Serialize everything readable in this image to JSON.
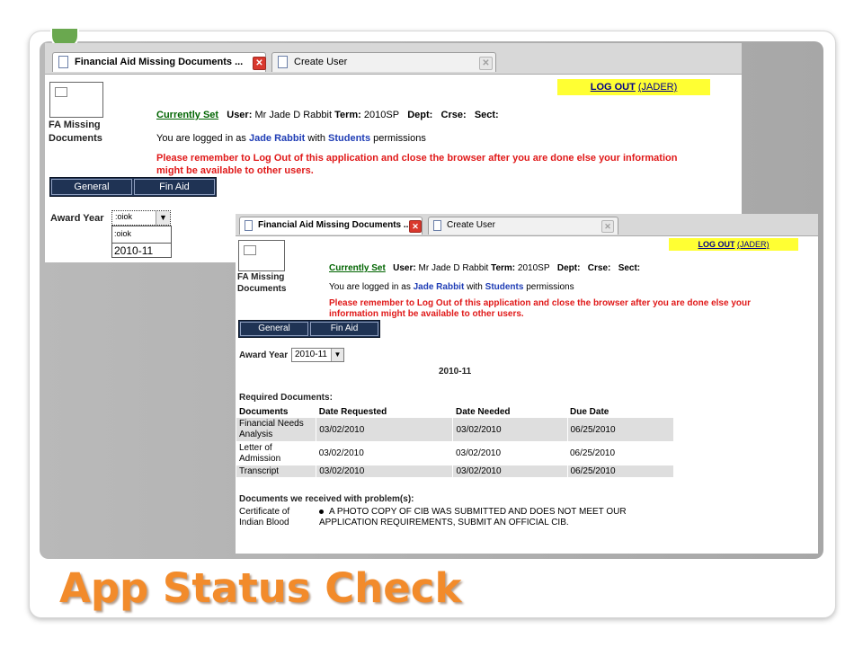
{
  "slide_title": "App Status Check",
  "colors": {
    "title_orange": "#f28b2b",
    "nav_bg": "#1f3354",
    "warning_red": "#e01919",
    "link_green": "#006400",
    "logout_bg": "#ffff33"
  },
  "tabs": [
    {
      "label": "Financial Aid Missing Documents ...",
      "icon": "page-icon",
      "close_icon": "close-icon"
    },
    {
      "label": "Create User",
      "icon": "page-icon",
      "close_icon": "close-icon"
    }
  ],
  "logout": {
    "link": "LOG OUT",
    "user": "(JADER)"
  },
  "app_logo_label": [
    "FA Missing",
    "Documents"
  ],
  "context": {
    "currently_set": "Currently Set",
    "user_label": "User:",
    "user_value": "Mr Jade D Rabbit",
    "term_label": "Term:",
    "term_value": "2010SP",
    "dept_label": "Dept:",
    "crse_label": "Crse:",
    "sect_label": "Sect:"
  },
  "login_line": {
    "prefix": "You are logged in as",
    "name": "Jade Rabbit",
    "with": "with",
    "role": "Students",
    "suffix": "permissions"
  },
  "warning_text": "Please remember to Log Out of this application and close the browser after you are done else your information might be available to other users.",
  "nav": [
    "General",
    "Fin Aid"
  ],
  "award_year": {
    "label": "Award Year",
    "open_value": ":oiok",
    "options": [
      ":oiok",
      "2010-11"
    ],
    "selected": "2010-11"
  },
  "section_heading": "2010-11",
  "required_docs": {
    "heading": "Required Documents:",
    "columns": [
      "Documents",
      "Date Requested",
      "Date Needed",
      "Due Date"
    ],
    "rows": [
      {
        "document": [
          "Financial Needs",
          "Analysis"
        ],
        "requested": "03/02/2010",
        "needed": "03/02/2010",
        "due": "06/25/2010"
      },
      {
        "document": [
          "Letter of",
          "Admission"
        ],
        "requested": "03/02/2010",
        "needed": "03/02/2010",
        "due": "06/25/2010"
      },
      {
        "document": [
          "Transcript"
        ],
        "requested": "03/02/2010",
        "needed": "03/02/2010",
        "due": "06/25/2010"
      }
    ]
  },
  "problem_docs": {
    "heading": "Documents we received with problem(s):",
    "rows": [
      {
        "document": [
          "Certificate of",
          "Indian Blood"
        ],
        "issue": [
          "A PHOTO COPY OF CIB WAS SUBMITTED AND DOES NOT MEET OUR",
          "APPLICATION REQUIREMENTS, SUBMIT AN OFFICIAL CIB."
        ]
      }
    ]
  }
}
